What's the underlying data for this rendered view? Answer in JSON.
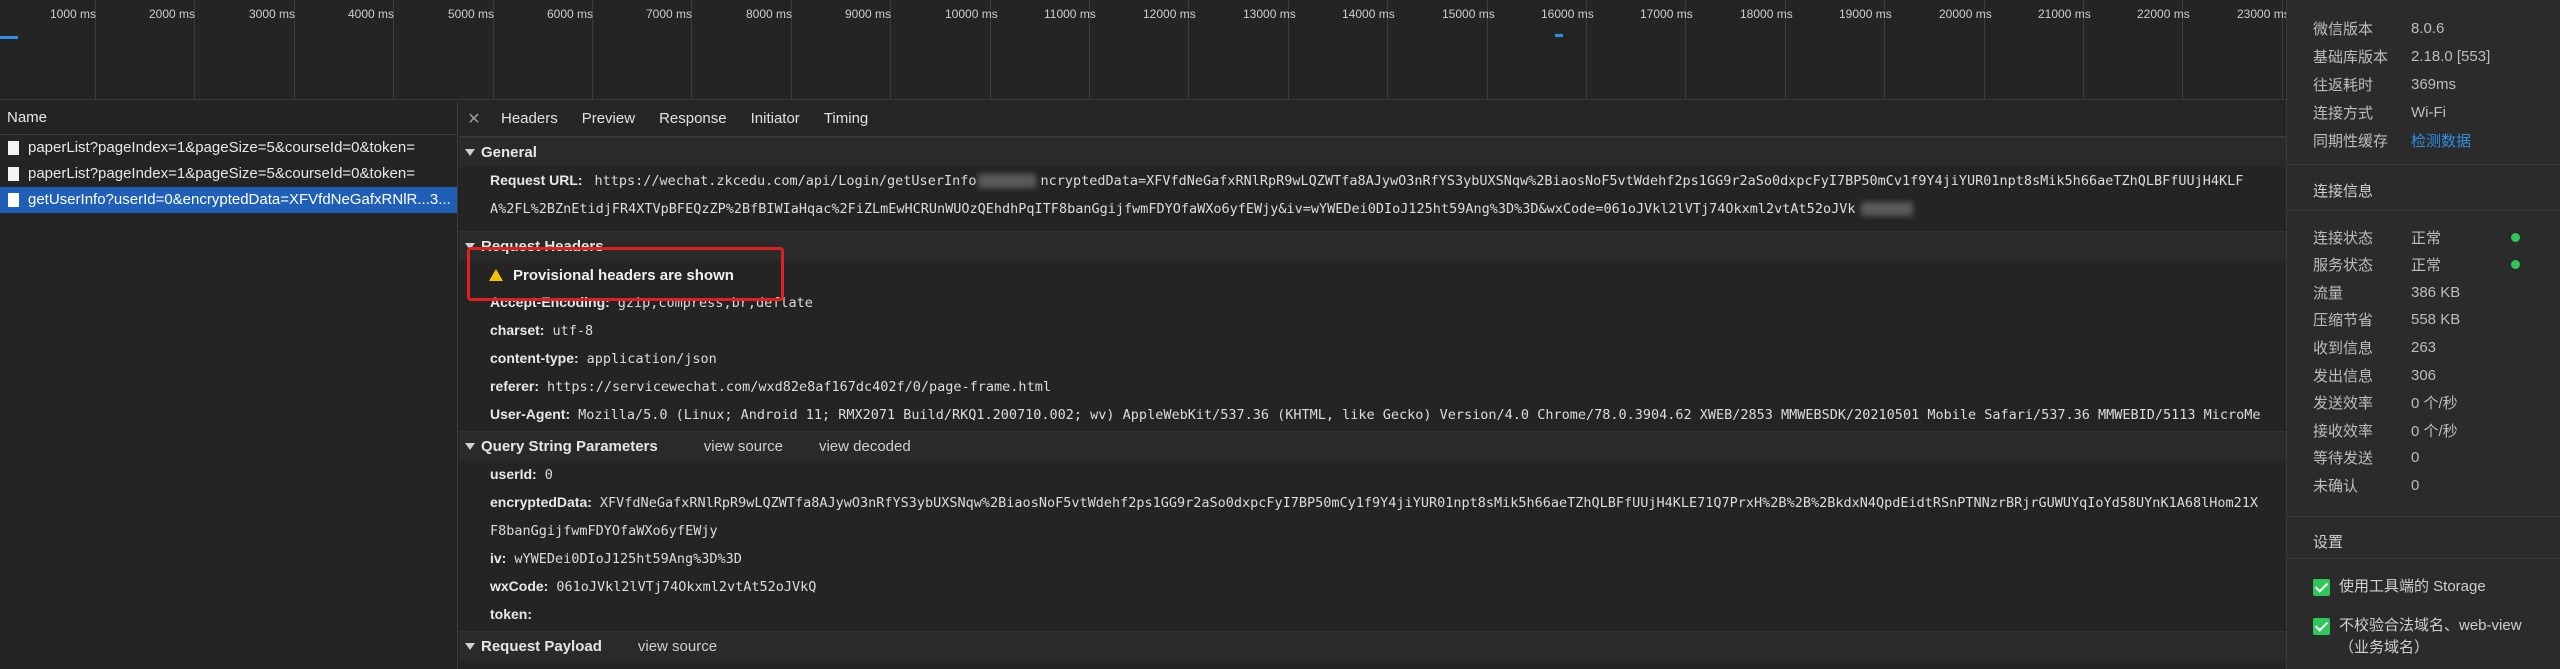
{
  "timeline": {
    "ticks": [
      "1000 ms",
      "2000 ms",
      "3000 ms",
      "4000 ms",
      "5000 ms",
      "6000 ms",
      "7000 ms",
      "8000 ms",
      "9000 ms",
      "10000 ms",
      "11000 ms",
      "12000 ms",
      "13000 ms",
      "14000 ms",
      "15000 ms",
      "16000 ms",
      "17000 ms",
      "18000 ms",
      "19000 ms",
      "20000 ms",
      "21000 ms",
      "22000 ms",
      "23000 ms"
    ]
  },
  "request_list": {
    "header": "Name",
    "rows": [
      {
        "name": "paperList?pageIndex=1&pageSize=5&courseId=0&token=",
        "selected": false
      },
      {
        "name": "paperList?pageIndex=1&pageSize=5&courseId=0&token=",
        "selected": false
      },
      {
        "name": "getUserInfo?userId=0&encryptedData=XFVfdNeGafxRNlR...3...",
        "selected": true
      }
    ]
  },
  "tabs": [
    "Headers",
    "Preview",
    "Response",
    "Initiator",
    "Timing"
  ],
  "active_tab": "Headers",
  "general": {
    "title": "General",
    "request_url_label": "Request URL:",
    "request_url_line1": "https://wechat.zkcedu.com/api/Login/getUserInfo",
    "request_url_line1b": "ncryptedData=XFVfdNeGafxRNlRpR9wLQZWTfa8AJywO3nRfYS3ybUXSNqw%2BiaosNoF5vtWdehf2ps1GG9r2aSo0dxpcFyI7BP50mCv1f9Y4jiYUR01npt8sMik5h66aeTZhQLBFfUUjH4KLF",
    "request_url_line2": "A%2FL%2BZnEtidjFR4XTVpBFEQzZP%2BfBIWIaHqac%2FiZLmEwHCRUnWUOzQEhdhPqITF8banGgijfwmFDYOfaWXo6yfEWjy&iv=wYWEDei0DIoJ125ht59Ang%3D%3D&wxCode=061oJVkl2lVTj74Okxml2vtAt52oJVk"
  },
  "request_headers": {
    "title": "Request Headers",
    "warning": "Provisional headers are shown",
    "items": [
      {
        "key": "Accept-Encoding:",
        "value": "gzip,compress,br,deflate"
      },
      {
        "key": "charset:",
        "value": "utf-8"
      },
      {
        "key": "content-type:",
        "value": "application/json"
      },
      {
        "key": "referer:",
        "value": "https://servicewechat.com/wxd82e8af167dc402f/0/page-frame.html"
      },
      {
        "key": "User-Agent:",
        "value": "Mozilla/5.0 (Linux; Android 11; RMX2071 Build/RKQ1.200710.002; wv) AppleWebKit/537.36 (KHTML, like Gecko) Version/4.0 Chrome/78.0.3904.62 XWEB/2853 MMWEBSDK/20210501 Mobile Safari/537.36 MMWEBID/5113 MicroMe"
      }
    ]
  },
  "query_params": {
    "title": "Query String Parameters",
    "view_source": "view source",
    "view_decoded": "view decoded",
    "items": [
      {
        "key": "userId:",
        "value": "0"
      },
      {
        "key": "encryptedData:",
        "value": "XFVfdNeGafxRNlRpR9wLQZWTfa8AJywO3nRfYS3ybUXSNqw%2BiaosNoF5vtWdehf2ps1GG9r2aSo0dxpcFyI7BP50mCy1f9Y4jiYUR01npt8sMik5h66aeTZhQLBFfUUjH4KLE71Q7PrxH%2B%2B%2BkdxN4QpdEidtRSnPTNNzrBRjrGUWUYqIoYd58UYnK1A68lHom21X"
      },
      {
        "key": "",
        "value": "F8banGgijfwmFDYOfaWXo6yfEWjy"
      },
      {
        "key": "iv:",
        "value": "wYWEDei0DIoJ125ht59Ang%3D%3D"
      },
      {
        "key": "wxCode:",
        "value": "061oJVkl2lVTj74Okxml2vtAt52oJVkQ"
      },
      {
        "key": "token:",
        "value": ""
      }
    ]
  },
  "request_payload": {
    "title": "Request Payload",
    "view_source": "view source"
  },
  "info_panel": {
    "top_rows": [
      {
        "label": "微信版本",
        "value": "8.0.6"
      },
      {
        "label": "基础库版本",
        "value": "2.18.0 [553]"
      },
      {
        "label": "往返耗时",
        "value": "369ms"
      },
      {
        "label": "连接方式",
        "value": "Wi-Fi"
      },
      {
        "label": "同期性缓存",
        "value": "检测数据"
      }
    ],
    "conn_title": "连接信息",
    "conn_rows": [
      {
        "label": "连接状态",
        "value": "正常",
        "status": true
      },
      {
        "label": "服务状态",
        "value": "正常",
        "status": true
      },
      {
        "label": "流量",
        "value": "386 KB"
      },
      {
        "label": "压缩节省",
        "value": "558 KB"
      },
      {
        "label": "收到信息",
        "value": "263"
      },
      {
        "label": "发出信息",
        "value": "306"
      },
      {
        "label": "发送效率",
        "value": "0 个/秒"
      },
      {
        "label": "接收效率",
        "value": "0 个/秒"
      },
      {
        "label": "等待发送",
        "value": "0"
      },
      {
        "label": "未确认",
        "value": "0"
      }
    ],
    "settings_title": "设置",
    "settings": [
      {
        "label": "使用工具端的 Storage",
        "checked": true
      },
      {
        "label": "不校验合法域名、web-view（业务域名）",
        "checked": true
      }
    ],
    "status_color": "#2fc75a",
    "link_color": "#2f8ee6"
  }
}
